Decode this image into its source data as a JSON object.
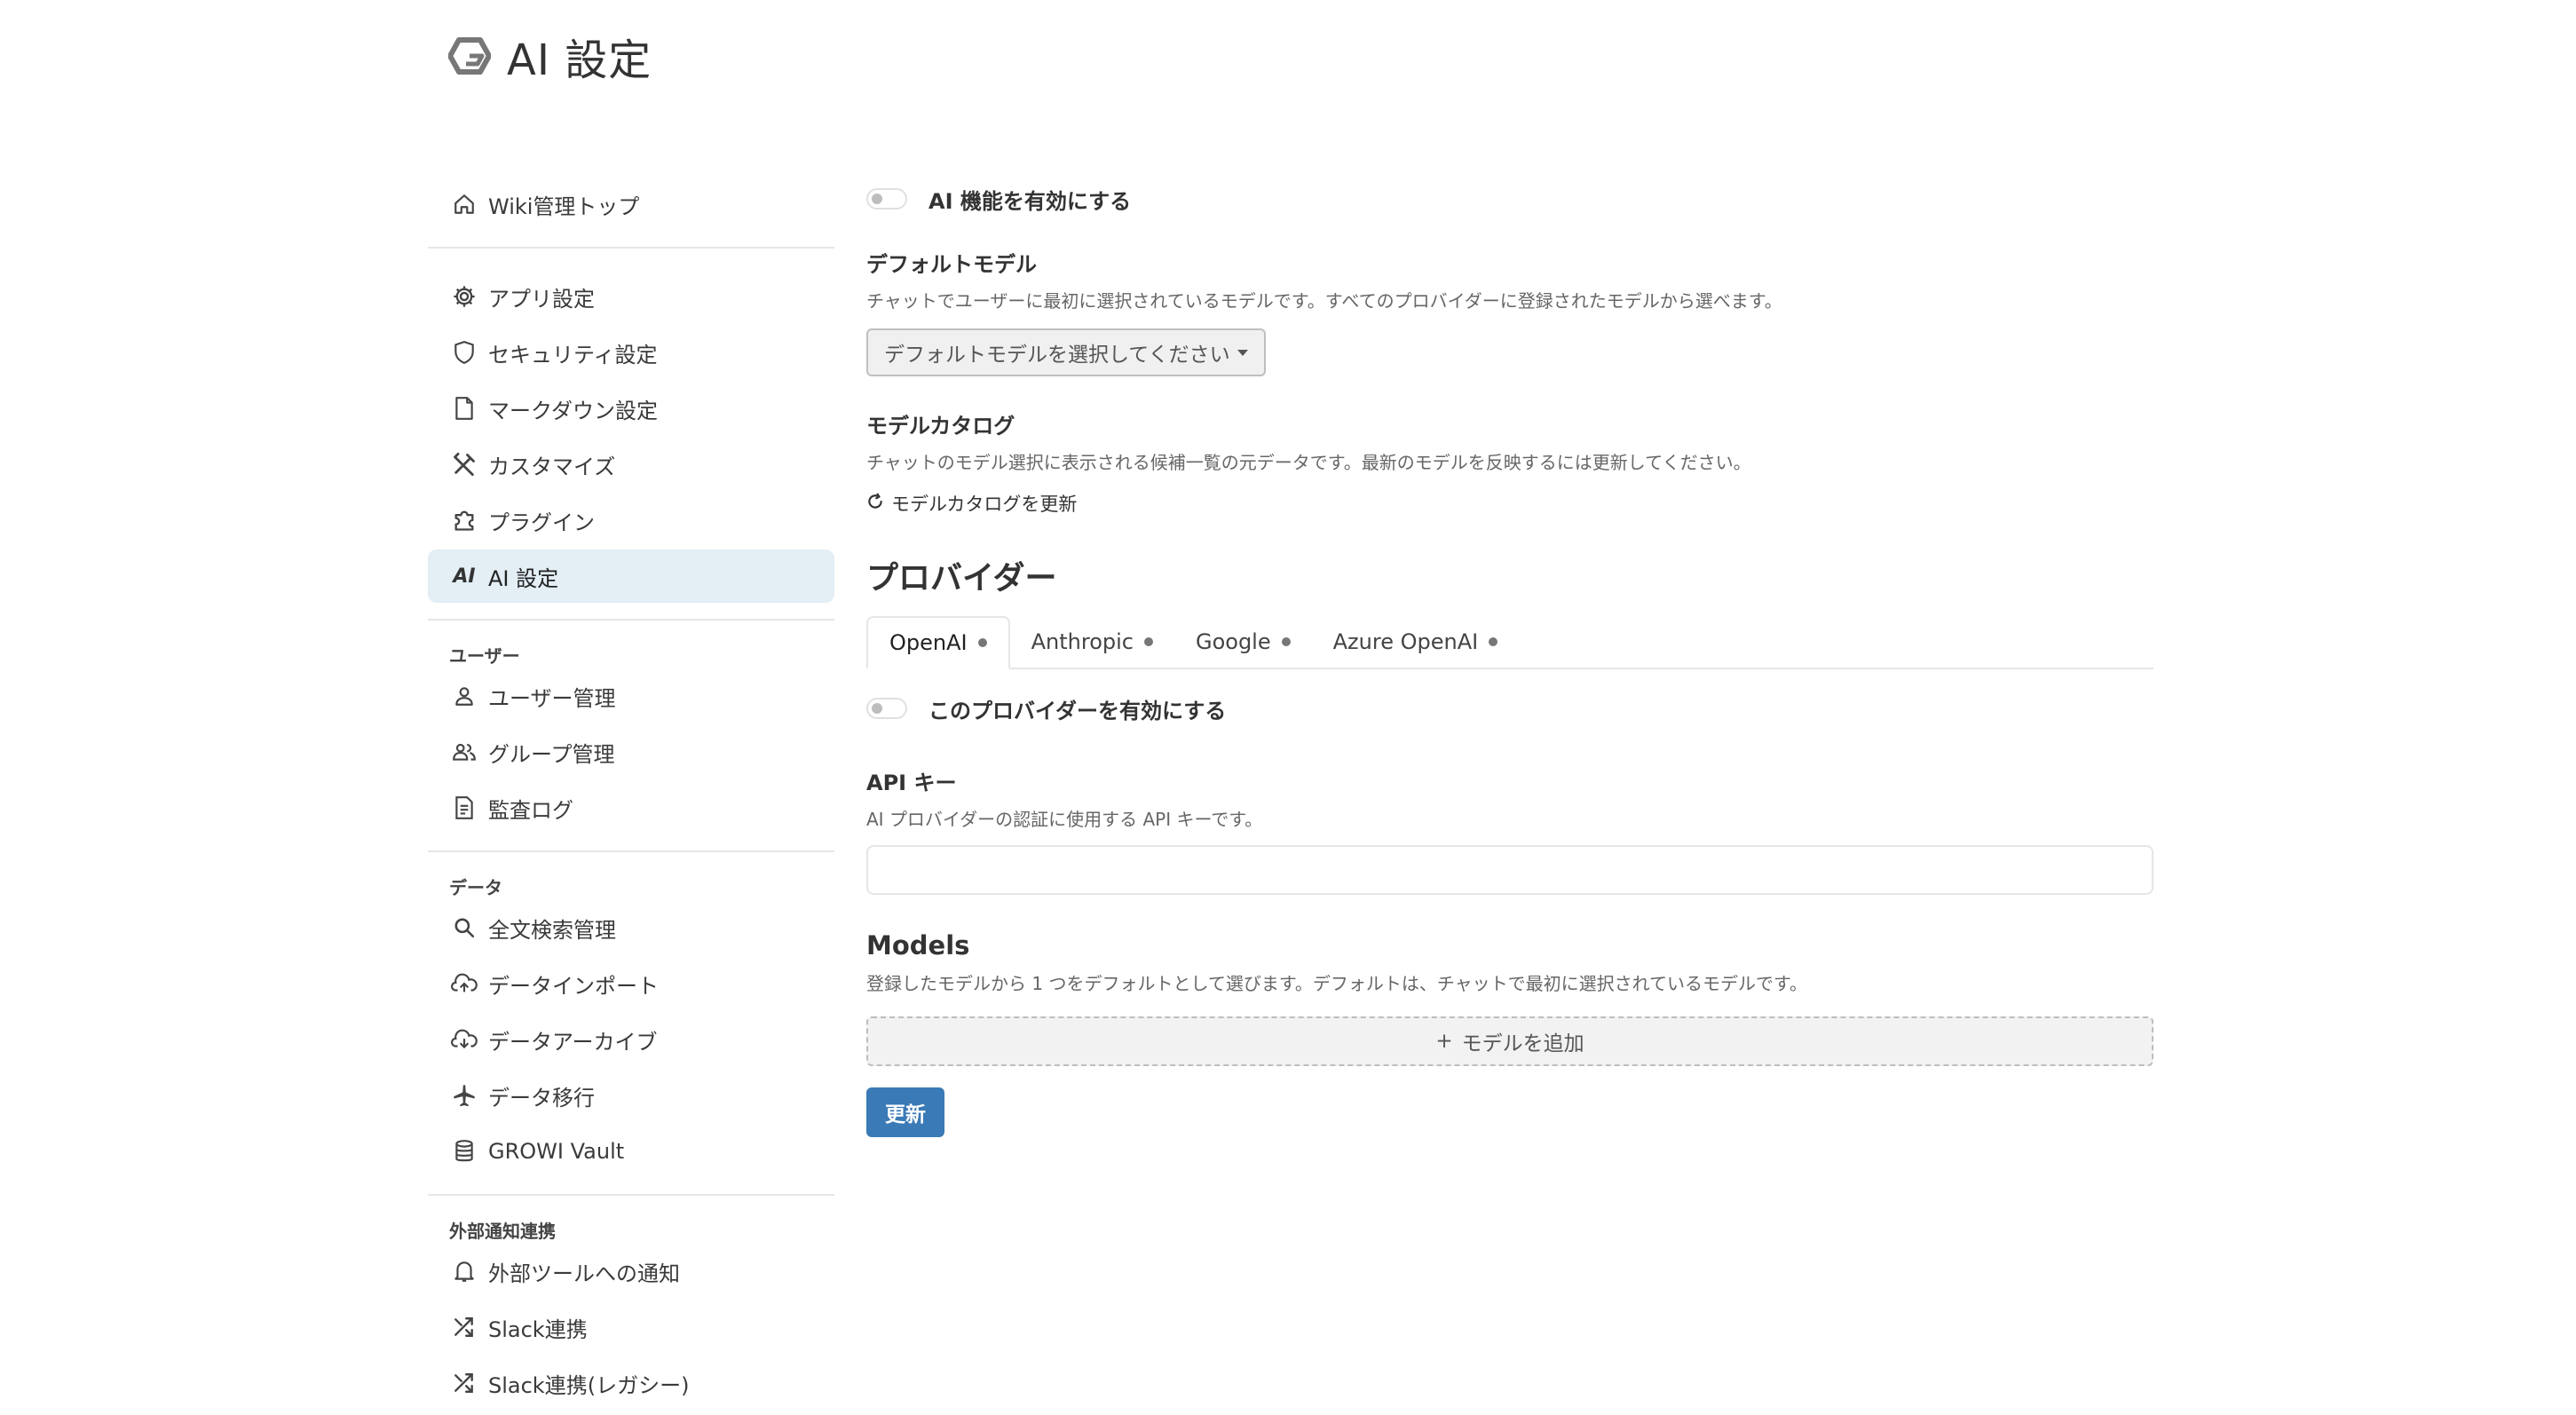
{
  "header": {
    "title": "AI 設定"
  },
  "sidebar": {
    "top": [
      {
        "label": "Wiki管理トップ",
        "icon": "home-icon"
      }
    ],
    "settings": [
      {
        "label": "アプリ設定",
        "icon": "gear-icon"
      },
      {
        "label": "セキュリティ設定",
        "icon": "shield-icon"
      },
      {
        "label": "マークダウン設定",
        "icon": "file-icon"
      },
      {
        "label": "カスタマイズ",
        "icon": "tools-icon"
      },
      {
        "label": "プラグイン",
        "icon": "puzzle-icon"
      },
      {
        "label": "AI 設定",
        "icon": "ai-icon",
        "active": true
      }
    ],
    "users": {
      "title": "ユーザー",
      "items": [
        {
          "label": "ユーザー管理",
          "icon": "user-icon"
        },
        {
          "label": "グループ管理",
          "icon": "group-icon"
        },
        {
          "label": "監査ログ",
          "icon": "log-icon"
        }
      ]
    },
    "data": {
      "title": "データ",
      "items": [
        {
          "label": "全文検索管理",
          "icon": "search-icon"
        },
        {
          "label": "データインポート",
          "icon": "cloud-upload-icon"
        },
        {
          "label": "データアーカイブ",
          "icon": "cloud-download-icon"
        },
        {
          "label": "データ移行",
          "icon": "airplane-icon"
        },
        {
          "label": "GROWI Vault",
          "icon": "database-icon"
        }
      ]
    },
    "external": {
      "title": "外部通知連携",
      "items": [
        {
          "label": "外部ツールへの通知",
          "icon": "bell-icon"
        },
        {
          "label": "Slack連携",
          "icon": "shuffle-icon"
        },
        {
          "label": "Slack連携(レガシー)",
          "icon": "shuffle-icon"
        }
      ]
    }
  },
  "main": {
    "ai_toggle_label": "AI 機能を有効にする",
    "default_model": {
      "title": "デフォルトモデル",
      "description": "チャットでユーザーに最初に選択されているモデルです。すべてのプロバイダーに登録されたモデルから選べます。",
      "select_placeholder": "デフォルトモデルを選択してください"
    },
    "catalog": {
      "title": "モデルカタログ",
      "description": "チャットのモデル選択に表示される候補一覧の元データです。最新のモデルを反映するには更新してください。",
      "refresh_label": "モデルカタログを更新"
    },
    "providers": {
      "title": "プロバイダー",
      "tabs": [
        {
          "label": "OpenAI",
          "active": true
        },
        {
          "label": "Anthropic"
        },
        {
          "label": "Google"
        },
        {
          "label": "Azure OpenAI"
        }
      ],
      "enable_label": "このプロバイダーを有効にする",
      "api_key": {
        "title": "API キー",
        "description": "AI プロバイダーの認証に使用する API キーです。",
        "value": ""
      },
      "models": {
        "title": "Models",
        "description": "登録したモデルから 1 つをデフォルトとして選びます。デフォルトは、チャットで最初に選択されているモデルです。",
        "add_label": "モデルを追加",
        "add_prefix": "+"
      }
    },
    "update_label": "更新"
  }
}
